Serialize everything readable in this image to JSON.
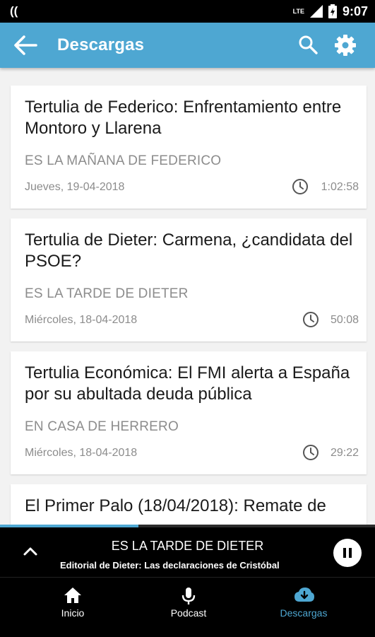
{
  "status_bar": {
    "time": "9:07",
    "network": "LTE",
    "icons": [
      "notification-icon",
      "signal-icon",
      "battery-icon"
    ]
  },
  "app_bar": {
    "title": "Descargas",
    "icons": [
      "back-arrow-icon",
      "search-icon",
      "gear-icon"
    ]
  },
  "downloads": [
    {
      "title": "Tertulia de Federico: Enfrentamiento entre Montoro y Llarena",
      "program": "ES LA MAÑANA DE FEDERICO",
      "date": "Jueves, 19-04-2018",
      "duration": "1:02:58"
    },
    {
      "title": "Tertulia de Dieter: Carmena, ¿candidata del PSOE?",
      "program": "ES LA TARDE DE DIETER",
      "date": "Miércoles, 18-04-2018",
      "duration": "50:08"
    },
    {
      "title": "Tertulia Económica: El FMI alerta a España por su abultada deuda pública",
      "program": "EN CASA DE HERRERO",
      "date": "Miércoles, 18-04-2018",
      "duration": "29:22"
    },
    {
      "title": "El Primer Palo (18/04/2018): Remate de",
      "program": "",
      "date": "",
      "duration": ""
    }
  ],
  "player": {
    "program": "ES LA TARDE DE DIETER",
    "episode": "Editorial de Dieter: Las declaraciones de Cristóbal",
    "progress": 0.37
  },
  "bottom_nav": [
    {
      "label": "Inicio",
      "icon": "home-icon",
      "active": false
    },
    {
      "label": "Podcast",
      "icon": "microphone-icon",
      "active": false
    },
    {
      "label": "Descargas",
      "icon": "cloud-download-icon",
      "active": true
    }
  ],
  "colors": {
    "accent": "#4ea7d2",
    "background": "#f2f2f2",
    "player_bg": "#000000"
  }
}
